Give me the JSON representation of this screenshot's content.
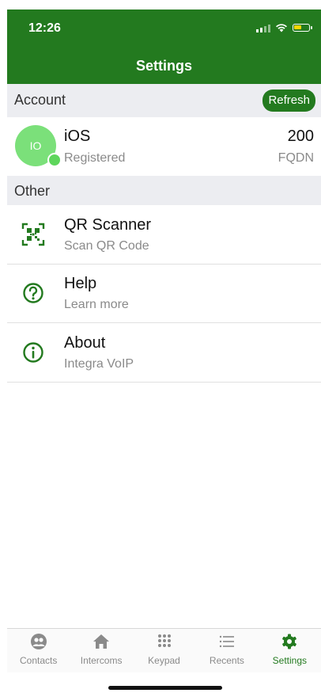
{
  "status_bar": {
    "time": "12:26"
  },
  "header": {
    "title": "Settings"
  },
  "sections": {
    "account": {
      "label": "Account",
      "refresh_label": "Refresh"
    },
    "other": {
      "label": "Other"
    }
  },
  "account": {
    "avatar_initials": "IO",
    "name": "iOS",
    "status": "Registered",
    "extension": "200",
    "type": "FQDN"
  },
  "menu": [
    {
      "title": "QR Scanner",
      "subtitle": "Scan QR Code",
      "icon": "qr-code-icon"
    },
    {
      "title": "Help",
      "subtitle": "Learn more",
      "icon": "help-icon"
    },
    {
      "title": "About",
      "subtitle": "Integra VoIP",
      "icon": "info-icon"
    }
  ],
  "tabs": [
    {
      "label": "Contacts",
      "icon": "contacts-icon"
    },
    {
      "label": "Intercoms",
      "icon": "home-icon"
    },
    {
      "label": "Keypad",
      "icon": "keypad-icon"
    },
    {
      "label": "Recents",
      "icon": "list-icon"
    },
    {
      "label": "Settings",
      "icon": "gear-icon",
      "active": true
    }
  ],
  "colors": {
    "brand_green": "#237a1f",
    "avatar_green": "#7be07a",
    "section_bg": "#ecedf1"
  }
}
